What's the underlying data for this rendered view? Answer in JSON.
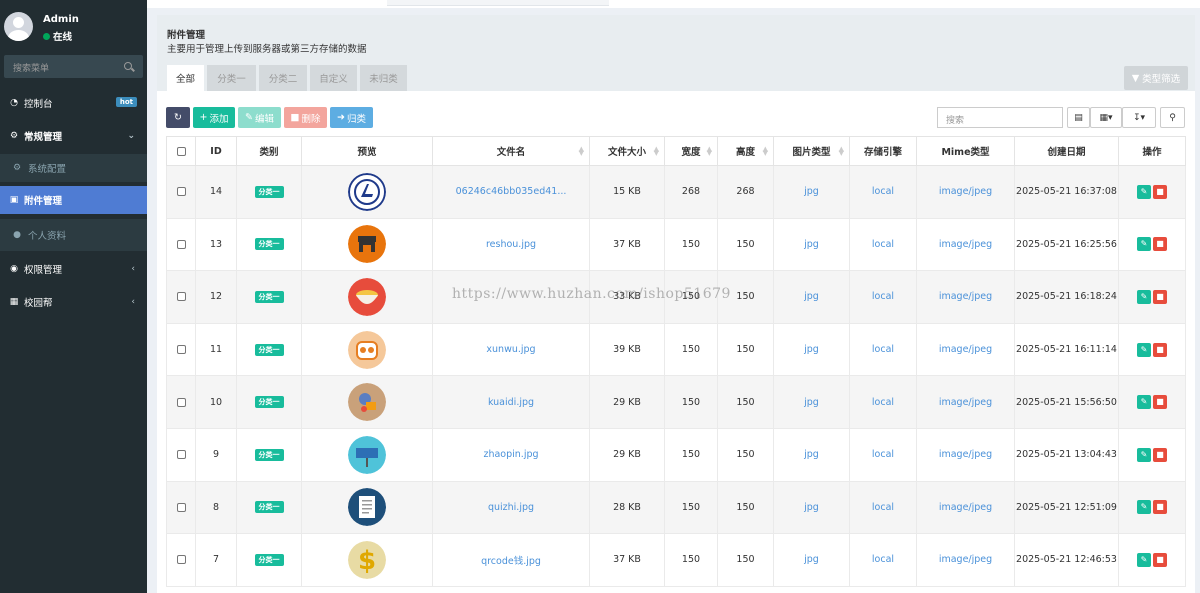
{
  "user": {
    "name": "Admin",
    "status": "在线"
  },
  "sidebar": {
    "search_placeholder": "搜索菜单",
    "items": [
      {
        "label": "控制台",
        "badge": "hot",
        "icon": "dashboard-icon"
      },
      {
        "label": "常规管理",
        "icon": "cogs-icon",
        "expanded": true
      },
      {
        "label": "系统配置",
        "icon": "gear-icon"
      },
      {
        "label": "附件管理",
        "icon": "file-image-icon",
        "active": true
      },
      {
        "label": "个人资料",
        "icon": "user-icon"
      },
      {
        "label": "权限管理",
        "icon": "group-icon"
      },
      {
        "label": "校园帮",
        "icon": "sitemap-icon"
      }
    ]
  },
  "panel": {
    "title": "附件管理",
    "description": "主要用于管理上传到服务器或第三方存储的数据",
    "tabs": [
      "全部",
      "分类一",
      "分类二",
      "自定义",
      "未归类"
    ],
    "type_filter": "类型筛选"
  },
  "toolbar": {
    "add": "添加",
    "edit": "编辑",
    "delete": "删除",
    "classify": "归类",
    "search_placeholder": "搜索"
  },
  "table": {
    "columns": [
      "ID",
      "类别",
      "预览",
      "文件名",
      "文件大小",
      "宽度",
      "高度",
      "图片类型",
      "存储引擎",
      "Mime类型",
      "创建日期",
      "操作"
    ],
    "rows": [
      {
        "id": "14",
        "category": "分类一",
        "thumb": "logo-emblem",
        "filename": "06246c46bb035ed41...",
        "size": "15 KB",
        "width": "268",
        "height": "268",
        "imagetype": "jpg",
        "storage": "local",
        "mime": "image/jpeg",
        "created": "2025-05-21 16:37:08"
      },
      {
        "id": "13",
        "category": "分类一",
        "thumb": "shop",
        "filename": "reshou.jpg",
        "size": "37 KB",
        "width": "150",
        "height": "150",
        "imagetype": "jpg",
        "storage": "local",
        "mime": "image/jpeg",
        "created": "2025-05-21 16:25:56"
      },
      {
        "id": "12",
        "category": "分类一",
        "thumb": "food-bowl",
        "filename": "",
        "size": "33 KB",
        "width": "150",
        "height": "150",
        "imagetype": "jpg",
        "storage": "local",
        "mime": "image/jpeg",
        "created": "2025-05-21 16:18:24"
      },
      {
        "id": "11",
        "category": "分类一",
        "thumb": "owl",
        "filename": "xunwu.jpg",
        "size": "39 KB",
        "width": "150",
        "height": "150",
        "imagetype": "jpg",
        "storage": "local",
        "mime": "image/jpeg",
        "created": "2025-05-21 16:11:14"
      },
      {
        "id": "10",
        "category": "分类一",
        "thumb": "delivery",
        "filename": "kuaidi.jpg",
        "size": "29 KB",
        "width": "150",
        "height": "150",
        "imagetype": "jpg",
        "storage": "local",
        "mime": "image/jpeg",
        "created": "2025-05-21 15:56:50"
      },
      {
        "id": "9",
        "category": "分类一",
        "thumb": "sign",
        "filename": "zhaopin.jpg",
        "size": "29 KB",
        "width": "150",
        "height": "150",
        "imagetype": "jpg",
        "storage": "local",
        "mime": "image/jpeg",
        "created": "2025-05-21 13:04:43"
      },
      {
        "id": "8",
        "category": "分类一",
        "thumb": "document",
        "filename": "quizhi.jpg",
        "size": "28 KB",
        "width": "150",
        "height": "150",
        "imagetype": "jpg",
        "storage": "local",
        "mime": "image/jpeg",
        "created": "2025-05-21 12:51:09"
      },
      {
        "id": "7",
        "category": "分类一",
        "thumb": "dollar",
        "filename": "qrcode钱.jpg",
        "size": "37 KB",
        "width": "150",
        "height": "150",
        "imagetype": "jpg",
        "storage": "local",
        "mime": "image/jpeg",
        "created": "2025-05-21 12:46:53"
      }
    ]
  },
  "watermark": "https://www.huzhan.com/ishop51679",
  "colors": {
    "sidebar_bg": "#222d32",
    "active_menu": "#4f7cd3",
    "success": "#18bc9c",
    "danger": "#e74c3c",
    "primary": "#3c8dbc",
    "link": "#4a91d9"
  }
}
